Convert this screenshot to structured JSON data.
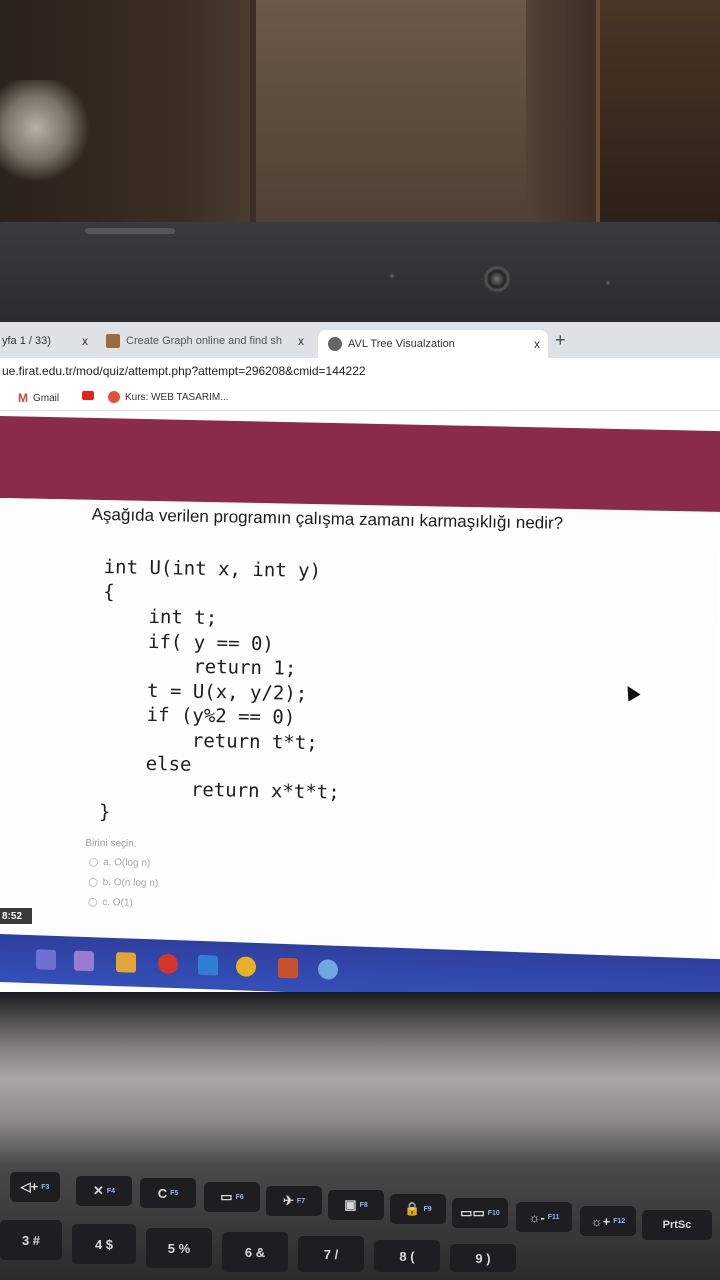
{
  "browser": {
    "tabs": [
      {
        "label": "yfa 1 / 33)"
      },
      {
        "label": "Create Graph online and find sh"
      },
      {
        "label": "AVL Tree Visualzation"
      }
    ],
    "new_tab_symbol": "+",
    "close_symbol": "x",
    "url": "ue.firat.edu.tr/mod/quiz/attempt.php?attempt=296208&cmid=144222",
    "bookmarks": [
      {
        "label": "Gmail",
        "icon": "gmail-icon"
      },
      {
        "label": "",
        "icon": "youtube-icon"
      },
      {
        "label": "Kurs: WEB TASARIM...",
        "icon": "kurs-icon"
      }
    ]
  },
  "quiz": {
    "question": "Aşağıda verilen programın çalışma zamanı karmaşıklığı nedir?",
    "code": "int U(int x, int y)\n{\n    int t;\n    if( y == 0)\n        return 1;\n    t = U(x, y/2);\n    if (y%2 == 0)\n        return t*t;\n    else\n        return x*t*t;\n}",
    "choose_label": "Birini seçin:",
    "options": [
      {
        "label": "a. O(log n)"
      },
      {
        "label": "b. O(n log n)"
      },
      {
        "label": "c. O(1)"
      }
    ]
  },
  "clock": "8:52",
  "keyboard": {
    "fn_keys": [
      {
        "glyph": "◁+",
        "fn": "F3"
      },
      {
        "glyph": "✕",
        "fn": "F4"
      },
      {
        "glyph": "C",
        "fn": "F5"
      },
      {
        "glyph": "▭",
        "fn": "F6"
      },
      {
        "glyph": "✈",
        "fn": "F7"
      },
      {
        "glyph": "▣",
        "fn": "F8"
      },
      {
        "glyph": "🔒",
        "fn": "F9"
      },
      {
        "glyph": "▭▭",
        "fn": "F10"
      },
      {
        "glyph": "☼-",
        "fn": "F11"
      },
      {
        "glyph": "☼+",
        "fn": "F12"
      },
      {
        "glyph": "PrtSc",
        "fn": ""
      }
    ],
    "num_keys": [
      "3 #",
      "4 $",
      "5 %",
      "6 &",
      "7 /",
      "8 (",
      "9 )"
    ]
  }
}
